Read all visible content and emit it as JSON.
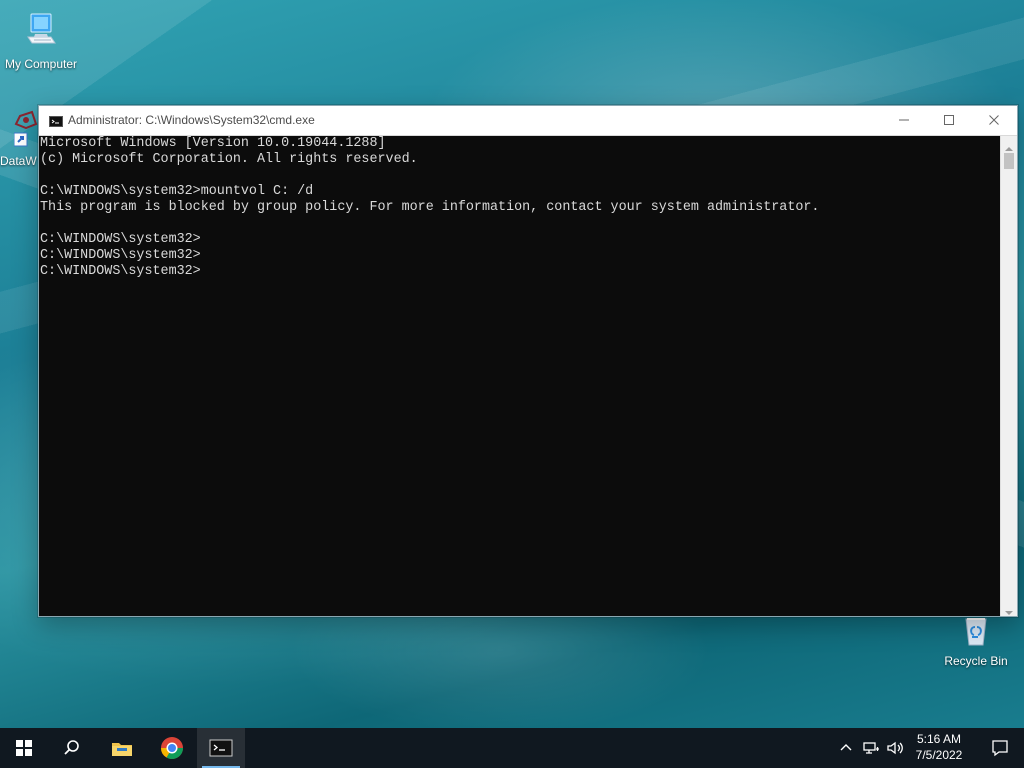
{
  "desktop": {
    "icons": [
      {
        "label": "My Computer",
        "icon": "computer-icon"
      },
      {
        "label": "DataW",
        "icon": "shortcut-icon"
      },
      {
        "label": "Recycle Bin",
        "icon": "recycle-bin-icon"
      }
    ]
  },
  "window": {
    "title": "Administrator: C:\\Windows\\System32\\cmd.exe",
    "icon": "cmd-icon",
    "controls": {
      "minimize_icon": "minimize-icon",
      "maximize_icon": "maximize-icon",
      "close_icon": "close-icon"
    },
    "console_text": "Microsoft Windows [Version 10.0.19044.1288]\n(c) Microsoft Corporation. All rights reserved.\n\nC:\\WINDOWS\\system32>mountvol C: /d\nThis program is blocked by group policy. For more information, contact your system administrator.\n\nC:\\WINDOWS\\system32>\nC:\\WINDOWS\\system32>\nC:\\WINDOWS\\system32>"
  },
  "taskbar": {
    "items": [
      "windows-start-icon",
      "search-icon",
      "file-explorer-icon",
      "chrome-icon",
      "cmd-icon"
    ],
    "tray": {
      "icons": [
        "chevron-up-icon",
        "network-icon",
        "volume-icon",
        "notification-icon"
      ],
      "time": "5:16 AM",
      "date": "7/5/2022"
    }
  },
  "colors": {
    "console_background": "#0c0c0c",
    "console_text": "#d9d9d9",
    "taskbar": "#101820",
    "accent": "#76b9ed"
  }
}
